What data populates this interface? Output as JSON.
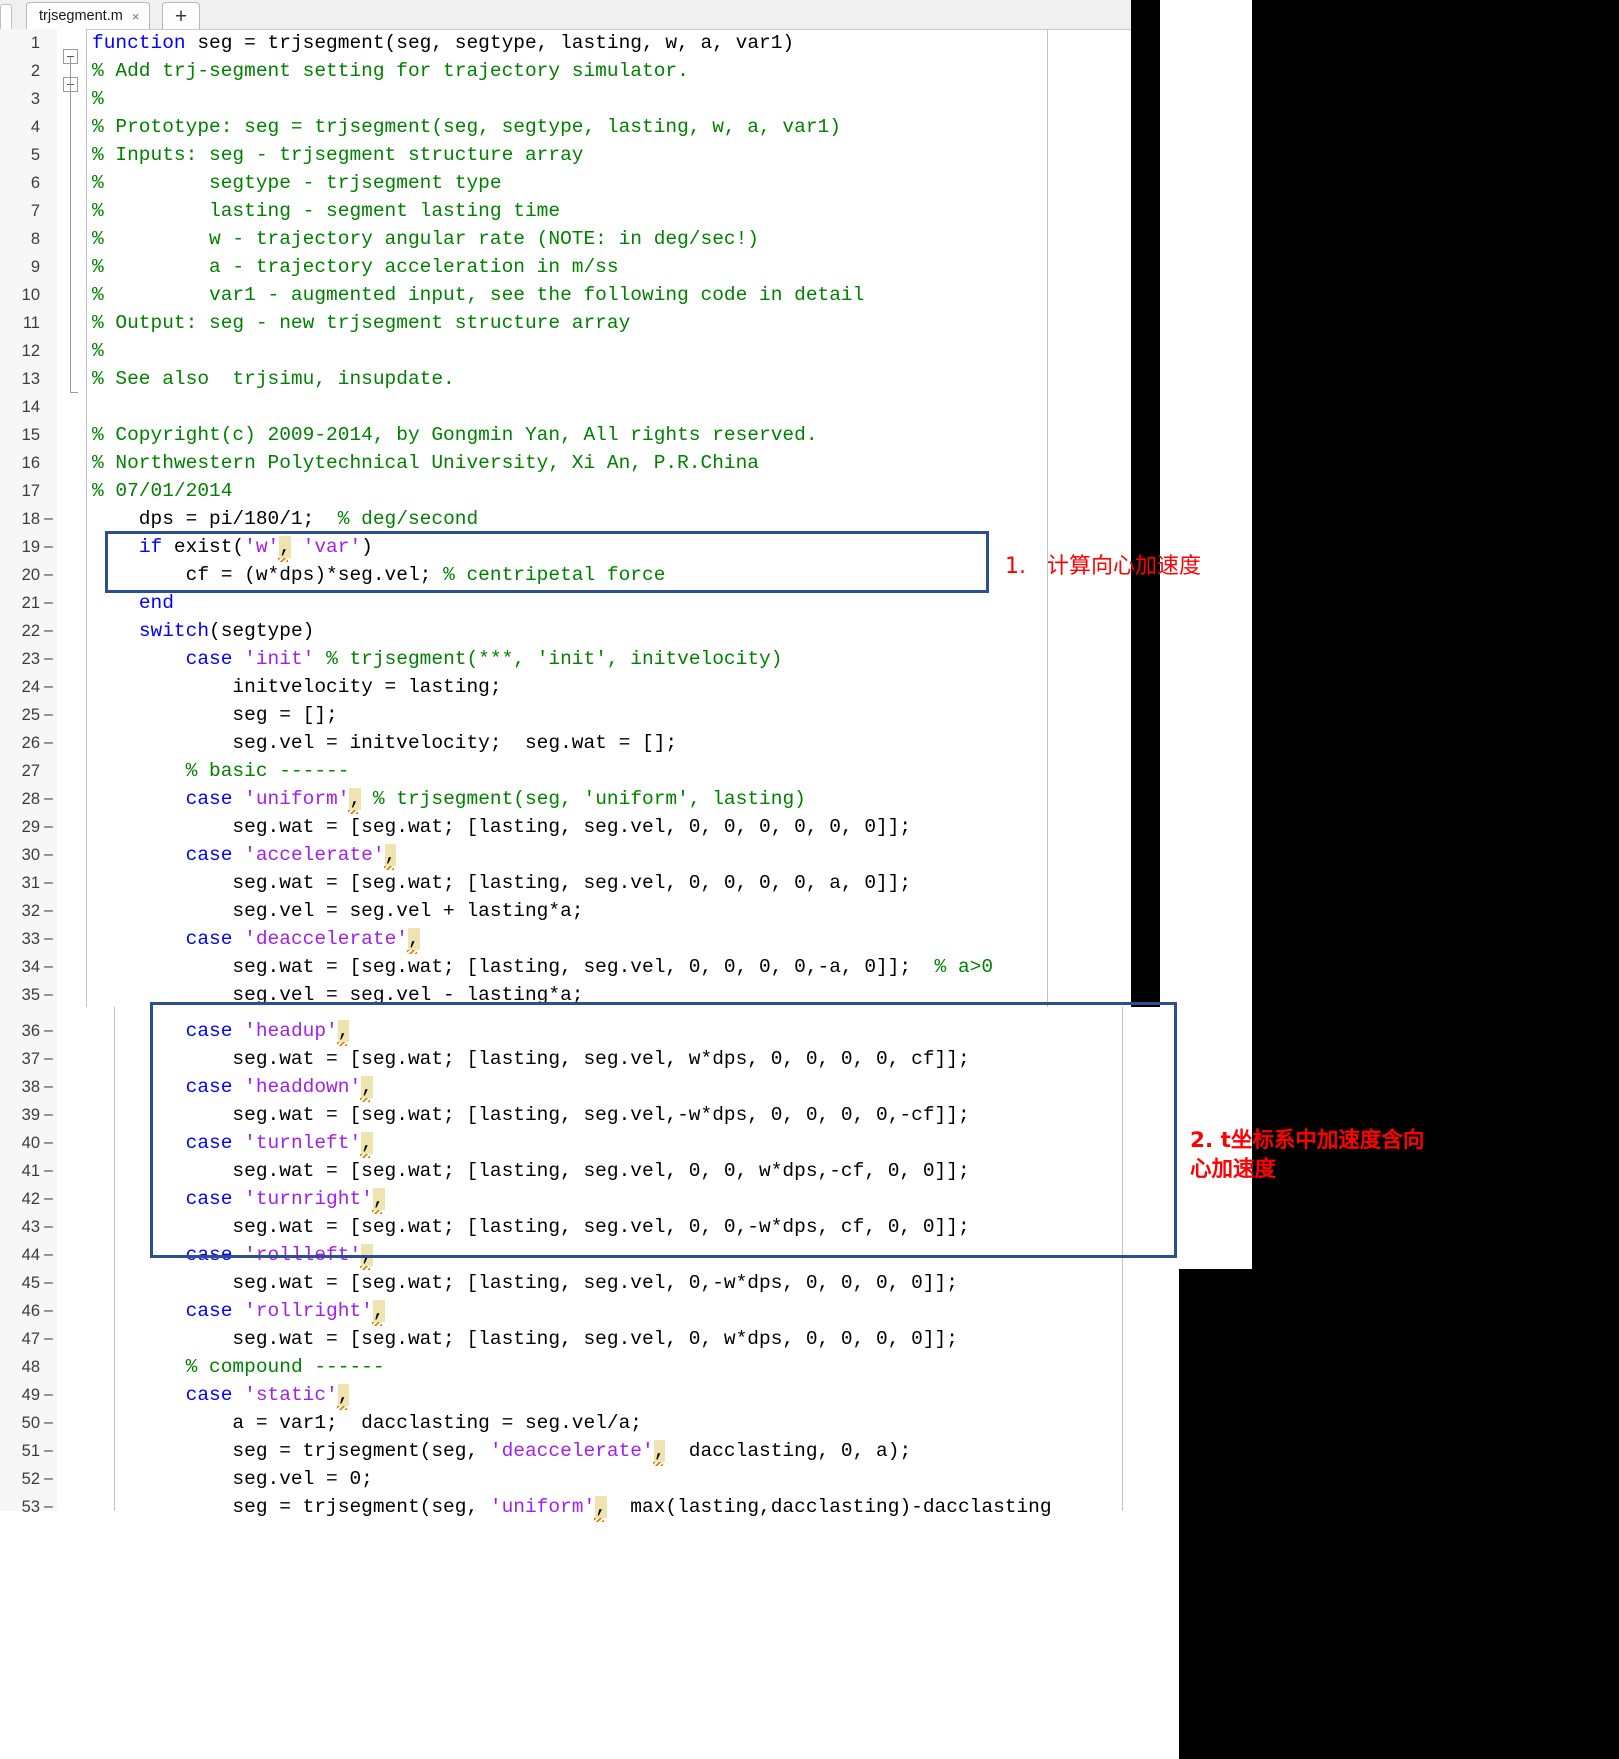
{
  "editor": {
    "tab": {
      "label": "trjsegment.m",
      "close_icon": "×",
      "new_tab_icon": "+"
    }
  },
  "annotations": {
    "note1": {
      "number": "1.",
      "text": "计算向心加速度"
    },
    "note2": {
      "text": "2. t坐标系中加速度含向心加速度"
    },
    "box_color": "#2d4f8e",
    "text_color": "#ff0000"
  },
  "code": {
    "colors": {
      "keyword": "#0000ff",
      "string": "#a020f0",
      "comment": "#008000",
      "plain": "#000000",
      "warning_highlight": "#efe4b0",
      "gutter_bg": "#f7f7f7"
    },
    "lines": [
      {
        "n": "1",
        "exec": false,
        "text": "function seg = trjsegment(seg, segtype, lasting, w, a, var1)"
      },
      {
        "n": "2",
        "exec": false,
        "text": "% Add trj-segment setting for trajectory simulator."
      },
      {
        "n": "3",
        "exec": false,
        "text": "%"
      },
      {
        "n": "4",
        "exec": false,
        "text": "% Prototype: seg = trjsegment(seg, segtype, lasting, w, a, var1)"
      },
      {
        "n": "5",
        "exec": false,
        "text": "% Inputs: seg - trjsegment structure array"
      },
      {
        "n": "6",
        "exec": false,
        "text": "%         segtype - trjsegment type"
      },
      {
        "n": "7",
        "exec": false,
        "text": "%         lasting - segment lasting time"
      },
      {
        "n": "8",
        "exec": false,
        "text": "%         w - trajectory angular rate (NOTE: in deg/sec!)"
      },
      {
        "n": "9",
        "exec": false,
        "text": "%         a - trajectory acceleration in m/ss"
      },
      {
        "n": "10",
        "exec": false,
        "text": "%         var1 - augmented input, see the following code in detail"
      },
      {
        "n": "11",
        "exec": false,
        "text": "% Output: seg - new trjsegment structure array"
      },
      {
        "n": "12",
        "exec": false,
        "text": "%"
      },
      {
        "n": "13",
        "exec": false,
        "text": "% See also  trjsimu, insupdate."
      },
      {
        "n": "14",
        "exec": false,
        "text": ""
      },
      {
        "n": "15",
        "exec": false,
        "text": "% Copyright(c) 2009-2014, by Gongmin Yan, All rights reserved."
      },
      {
        "n": "16",
        "exec": false,
        "text": "% Northwestern Polytechnical University, Xi An, P.R.China"
      },
      {
        "n": "17",
        "exec": false,
        "text": "% 07/01/2014"
      },
      {
        "n": "18",
        "exec": true,
        "text": "    dps = pi/180/1;  % deg/second"
      },
      {
        "n": "19",
        "exec": true,
        "text": "    if exist('w', 'var')"
      },
      {
        "n": "20",
        "exec": true,
        "text": "        cf = (w*dps)*seg.vel; % centripetal force"
      },
      {
        "n": "21",
        "exec": true,
        "text": "    end"
      },
      {
        "n": "22",
        "exec": true,
        "text": "    switch(segtype)"
      },
      {
        "n": "23",
        "exec": true,
        "text": "        case 'init' % trjsegment(***, 'init', initvelocity)"
      },
      {
        "n": "24",
        "exec": true,
        "text": "            initvelocity = lasting;"
      },
      {
        "n": "25",
        "exec": true,
        "text": "            seg = [];"
      },
      {
        "n": "26",
        "exec": true,
        "text": "            seg.vel = initvelocity;  seg.wat = [];"
      },
      {
        "n": "27",
        "exec": false,
        "text": "        % basic ------"
      },
      {
        "n": "28",
        "exec": true,
        "text": "        case 'uniform', % trjsegment(seg, 'uniform', lasting)"
      },
      {
        "n": "29",
        "exec": true,
        "text": "            seg.wat = [seg.wat; [lasting, seg.vel, 0, 0, 0, 0, 0, 0]];"
      },
      {
        "n": "30",
        "exec": true,
        "text": "        case 'accelerate',"
      },
      {
        "n": "31",
        "exec": true,
        "text": "            seg.wat = [seg.wat; [lasting, seg.vel, 0, 0, 0, 0, a, 0]];"
      },
      {
        "n": "32",
        "exec": true,
        "text": "            seg.vel = seg.vel + lasting*a;"
      },
      {
        "n": "33",
        "exec": true,
        "text": "        case 'deaccelerate',"
      },
      {
        "n": "34",
        "exec": true,
        "text": "            seg.wat = [seg.wat; [lasting, seg.vel, 0, 0, 0, 0,-a, 0]];  % a>0"
      },
      {
        "n": "35",
        "exec": true,
        "text": "            seg.vel = seg.vel - lasting*a;"
      },
      {
        "n": "36",
        "exec": true,
        "text": "        case 'headup',"
      },
      {
        "n": "37",
        "exec": true,
        "text": "            seg.wat = [seg.wat; [lasting, seg.vel, w*dps, 0, 0, 0, 0, cf]];"
      },
      {
        "n": "38",
        "exec": true,
        "text": "        case 'headdown',"
      },
      {
        "n": "39",
        "exec": true,
        "text": "            seg.wat = [seg.wat; [lasting, seg.vel,-w*dps, 0, 0, 0, 0,-cf]];"
      },
      {
        "n": "40",
        "exec": true,
        "text": "        case 'turnleft',"
      },
      {
        "n": "41",
        "exec": true,
        "text": "            seg.wat = [seg.wat; [lasting, seg.vel, 0, 0, w*dps,-cf, 0, 0]];"
      },
      {
        "n": "42",
        "exec": true,
        "text": "        case 'turnright',"
      },
      {
        "n": "43",
        "exec": true,
        "text": "            seg.wat = [seg.wat; [lasting, seg.vel, 0, 0,-w*dps, cf, 0, 0]];"
      },
      {
        "n": "44",
        "exec": true,
        "text": "        case 'rollleft',"
      },
      {
        "n": "45",
        "exec": true,
        "text": "            seg.wat = [seg.wat; [lasting, seg.vel, 0,-w*dps, 0, 0, 0, 0]];"
      },
      {
        "n": "46",
        "exec": true,
        "text": "        case 'rollright',"
      },
      {
        "n": "47",
        "exec": true,
        "text": "            seg.wat = [seg.wat; [lasting, seg.vel, 0, w*dps, 0, 0, 0, 0]];"
      },
      {
        "n": "48",
        "exec": false,
        "text": "        % compound ------"
      },
      {
        "n": "49",
        "exec": true,
        "text": "        case 'static',"
      },
      {
        "n": "50",
        "exec": true,
        "text": "            a = var1;  dacclasting = seg.vel/a;"
      },
      {
        "n": "51",
        "exec": true,
        "text": "            seg = trjsegment(seg, 'deaccelerate',  dacclasting, 0, a);"
      },
      {
        "n": "52",
        "exec": true,
        "text": "            seg.vel = 0;"
      },
      {
        "n": "53",
        "exec": true,
        "text": "            seg = trjsegment(seg, 'uniform',  max(lasting,dacclasting)-dacclasting"
      }
    ]
  }
}
